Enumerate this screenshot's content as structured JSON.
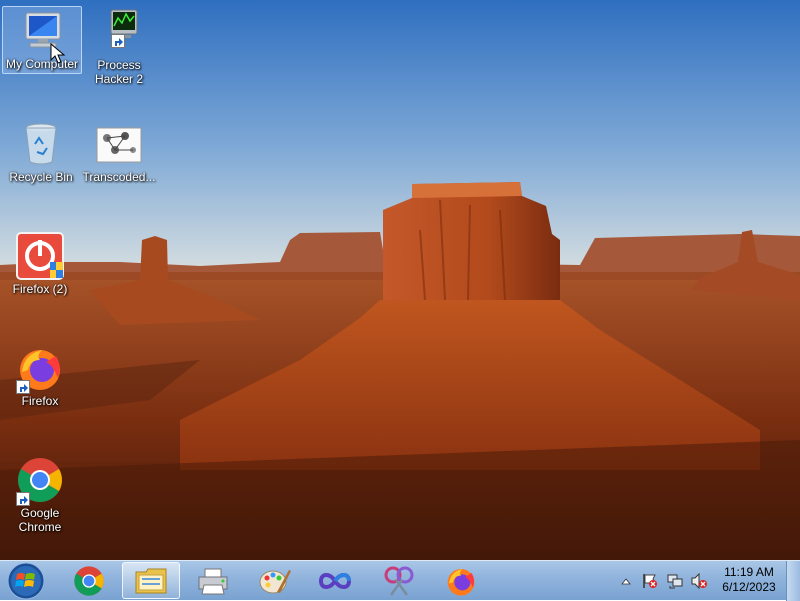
{
  "desktop": {
    "icons": [
      {
        "label": "My Computer",
        "icon": "computer-icon"
      },
      {
        "label": "Process Hacker 2",
        "icon": "process-hacker-icon"
      },
      {
        "label": "Recycle Bin",
        "icon": "recycle-bin-icon"
      },
      {
        "label": "Transcoded...",
        "icon": "image-file-icon"
      },
      {
        "label": "Firefox (2)",
        "icon": "firefox-installer-icon"
      },
      {
        "label": "Firefox",
        "icon": "firefox-icon"
      },
      {
        "label": "Google Chrome",
        "icon": "chrome-icon"
      }
    ]
  },
  "taskbar": {
    "pinned": [
      "start-orb",
      "chrome-icon",
      "explorer-icon",
      "printer-icon",
      "paint-icon",
      "infinity-icon",
      "scissors-icon",
      "firefox-icon"
    ],
    "tray": {
      "icons": [
        "show-hidden-icon",
        "flag-icon",
        "network-icon",
        "volume-muted-icon"
      ],
      "time": "11:19 AM",
      "date": "6/12/2023"
    }
  },
  "colors": {
    "sky_top": "#3d7cc9",
    "sky_bottom": "#bcd2e2",
    "rock": "#b84a18",
    "taskbar": "#8fb3dc"
  }
}
